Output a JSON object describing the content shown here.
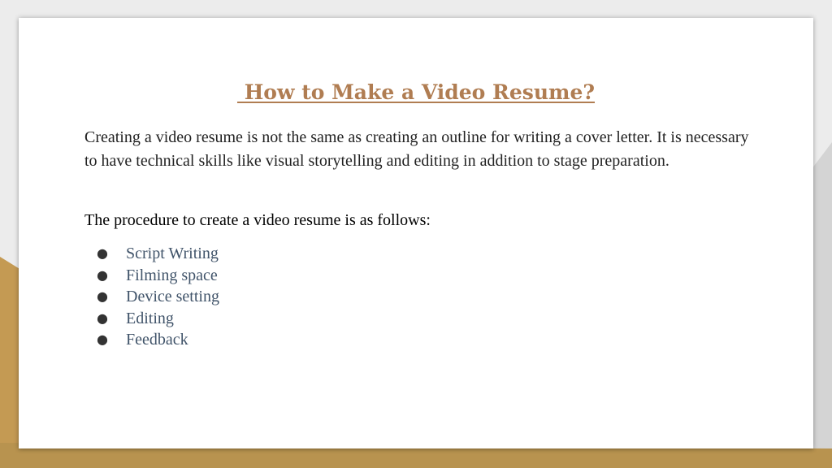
{
  "colors": {
    "accent_gold": "#c49a53",
    "title_brown": "#b07d52",
    "list_text": "#41546a",
    "background_grey": "#ececec"
  },
  "slide": {
    "title": " How to Make a Video Resume?",
    "paragraph": "Creating a video resume is not the same as creating an outline for writing a cover letter. It is necessary to have technical skills like visual storytelling and editing in addition to stage preparation.",
    "subheading": "The procedure to create a video resume is as follows:",
    "bullet_glyph": "●",
    "steps": [
      "Script Writing",
      "Filming space",
      "Device setting",
      "Editing",
      "Feedback"
    ]
  }
}
